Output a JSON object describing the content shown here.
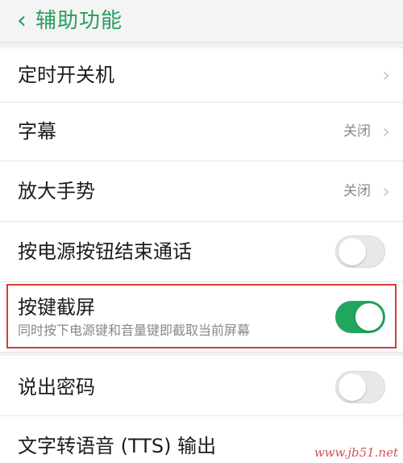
{
  "header": {
    "back_icon": "chevron-left-icon",
    "title": "辅助功能"
  },
  "rows": [
    {
      "label": "定时开关机",
      "status": "",
      "control": "chevron"
    },
    {
      "label": "字幕",
      "status": "关闭",
      "control": "chevron"
    },
    {
      "label": "放大手势",
      "status": "关闭",
      "control": "chevron"
    },
    {
      "label": "按电源按钮结束通话",
      "control": "toggle",
      "toggle_on": false
    },
    {
      "label": "按键截屏",
      "sub": "同时按下电源键和音量键即截取当前屏幕",
      "control": "toggle",
      "toggle_on": true
    },
    {
      "label": "说出密码",
      "control": "toggle",
      "toggle_on": false
    },
    {
      "label": "文字转语音 (TTS) 输出",
      "control": "none"
    }
  ],
  "colors": {
    "accent": "#2a9d5c",
    "toggle_on": "#22a55c",
    "highlight_border": "#d93a3a"
  },
  "watermark": "www.jb51.net"
}
